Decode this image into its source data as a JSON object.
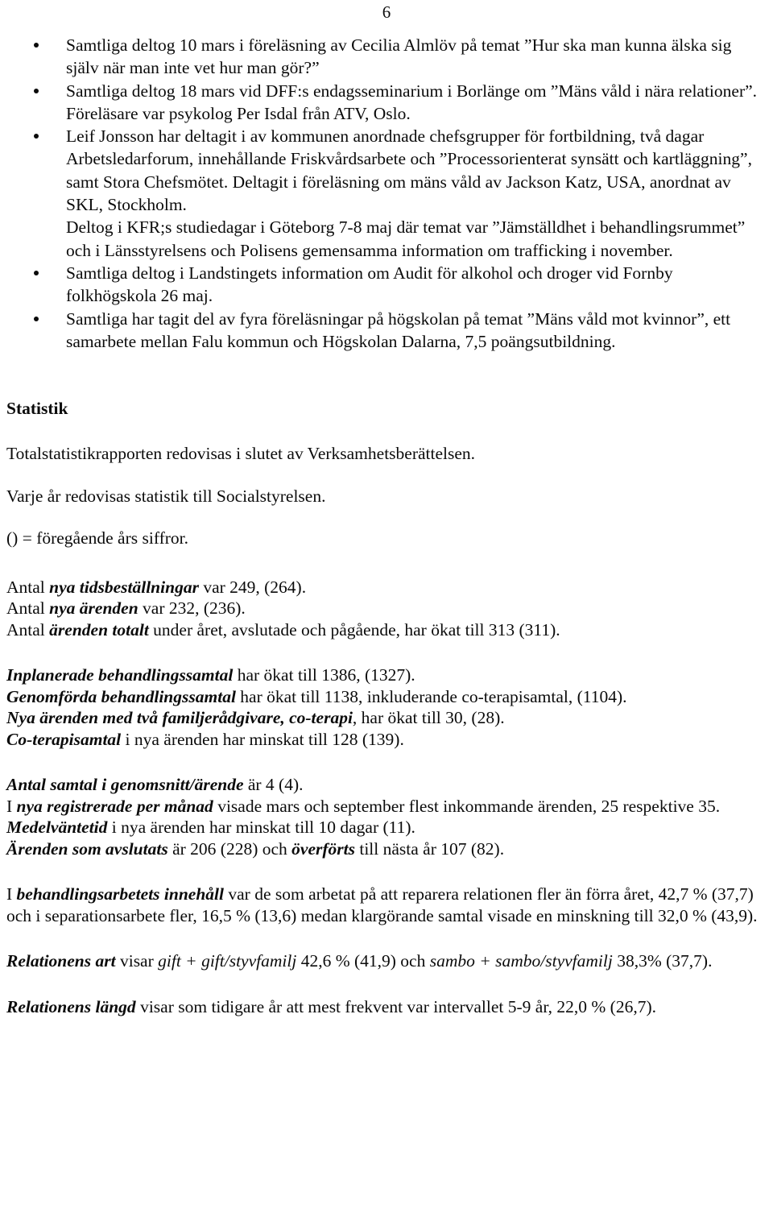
{
  "page": {
    "number": "6"
  },
  "bullets": [
    {
      "id": "bullet-cecilia-almlov",
      "paragraphs": [
        "Samtliga deltog 10 mars i föreläsning av Cecilia Almlöv på temat ”Hur ska man kunna älska sig själv när man inte vet hur man gör?”"
      ]
    },
    {
      "id": "bullet-dff-endagsseminarium",
      "paragraphs": [
        "Samtliga deltog 18 mars vid DFF:s endagsseminarium i Borlänge om ”Mäns våld i nära relationer”. Föreläsare var psykolog Per Isdal från ATV, Oslo."
      ]
    },
    {
      "id": "bullet-leif-jonsson",
      "paragraphs": [
        "Leif Jonsson har deltagit i av kommunen anordnade chefsgrupper för fortbildning, två dagar Arbetsledarforum, innehållande Friskvårdsarbete och ”Processorienterat synsätt och kartläggning”, samt Stora Chefsmötet. Deltagit i föreläsning om mäns våld av Jackson Katz, USA, anordnat av SKL, Stockholm.",
        "Deltog i KFR;s studiedagar i Göteborg 7-8 maj där temat var ”Jämställdhet i behandlingsrummet” och i Länsstyrelsens och Polisens gemensamma information om trafficking i november."
      ]
    },
    {
      "id": "bullet-landstinget-audit",
      "paragraphs": [
        "Samtliga deltog i Landstingets information om Audit för alkohol och droger vid Fornby folkhögskola 26 maj."
      ]
    },
    {
      "id": "bullet-hogskolan-forelasningar",
      "paragraphs": [
        "Samtliga har tagit del av fyra föreläsningar på högskolan på temat ”Mäns våld mot kvinnor”, ett samarbete mellan Falu kommun och Högskolan Dalarna, 7,5 poängsutbildning."
      ]
    }
  ],
  "statistics": {
    "heading": "Statistik",
    "intro_paragraphs": [
      "Totalstatistikrapporten redovisas i slutet av Verksamhetsberättelsen.",
      "Varje år redovisas statistik till Socialstyrelsen.",
      "() = föregående års siffror."
    ],
    "block1": [
      {
        "prefix": "Antal ",
        "emphasis": "nya tidsbeställningar",
        "suffix": " var 249, (264)."
      },
      {
        "prefix": "Antal ",
        "emphasis": "nya ärenden",
        "suffix": " var 232, (236)."
      },
      {
        "prefix": "Antal ",
        "emphasis": "ärenden totalt",
        "suffix": " under året, avslutade och pågående, har ökat till 313 (311)."
      }
    ],
    "block2": [
      {
        "prefix": "",
        "emphasis": "Inplanerade behandlingssamtal",
        "suffix": " har ökat till 1386, (1327)."
      },
      {
        "prefix": "",
        "emphasis": "Genomförda behandlingssamtal",
        "suffix": " har ökat till 1138, inkluderande co-terapisamtal, (1104)."
      },
      {
        "prefix": "",
        "emphasis": "Nya ärenden med två familjerådgivare, co-terapi",
        "suffix": ", har ökat till 30, (28)."
      },
      {
        "prefix": "",
        "emphasis": "Co-terapisamtal",
        "suffix": " i nya ärenden har minskat till 128 (139)."
      }
    ],
    "block3": [
      {
        "prefix": "",
        "emphasis": "Antal samtal i genomsnitt/ärende",
        "suffix": " är 4 (4)."
      },
      {
        "prefix": "I ",
        "emphasis": "nya registrerade per månad",
        "suffix": " visade mars och september flest inkommande ärenden, 25 respektive 35."
      },
      {
        "prefix": "",
        "emphasis": "Medelväntetid",
        "suffix": " i nya ärenden har minskat till 10 dagar (11)."
      }
    ],
    "avslutats": {
      "emphasis1": "Ärenden som avslutats",
      "mid": " är 206 (228) och ",
      "emphasis2": "överförts",
      "suffix": " till nästa år 107 (82)."
    },
    "behandlingsarbetet": {
      "prefix": "I ",
      "emphasis": "behandlingsarbetets innehåll",
      "suffix": " var de som arbetat på att reparera relationen fler än förra året, 42,7 % (37,7) och i separationsarbete fler, 16,5 % (13,6) medan klargörande samtal visade en minskning till 32,0 % (43,9)."
    },
    "relationens_art": {
      "emphasis": "Relationens art",
      "part1": " visar ",
      "italic1": "gift + gift/styvfamilj",
      "part2": " 42,6 % (41,9) och ",
      "italic2": "sambo + sambo/styvfamilj",
      "part3": " 38,3% (37,7)."
    },
    "relationens_langd": {
      "emphasis": "Relationens längd",
      "suffix": " visar som tidigare år att mest frekvent var intervallet 5-9 år, 22,0 % (26,7)."
    }
  }
}
